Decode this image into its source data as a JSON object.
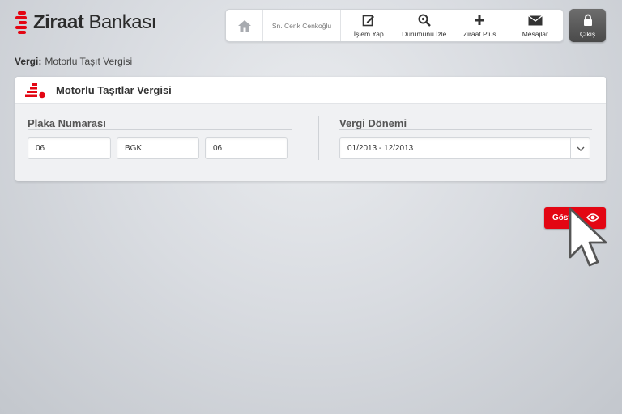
{
  "brand": {
    "name_bold": "Ziraat",
    "name_rest": " Bankası",
    "color": "#e30613"
  },
  "nav": {
    "home_icon": "home-icon",
    "user": "Sn. Cenk Cenkoğlu",
    "items": [
      {
        "label": "İşlem Yap",
        "icon": "edit-icon"
      },
      {
        "label": "Durumunu İzle",
        "icon": "search-icon"
      },
      {
        "label": "Ziraat Plus",
        "icon": "plus-icon"
      },
      {
        "label": "Mesajlar",
        "icon": "envelope-icon"
      }
    ],
    "exit": {
      "label": "Çıkış",
      "icon": "lock-icon"
    }
  },
  "breadcrumb": {
    "label": "Vergi:",
    "value": "Motorlu Taşıt Vergisi"
  },
  "panel": {
    "title": "Motorlu Taşıtlar Vergisi",
    "plate": {
      "label": "Plaka Numarası",
      "fields": [
        "06",
        "BGK",
        "06"
      ]
    },
    "period": {
      "label": "Vergi Dönemi",
      "value": "01/2013 - 12/2013"
    }
  },
  "show_button": {
    "label": "Göster",
    "icon": "eye-icon"
  }
}
